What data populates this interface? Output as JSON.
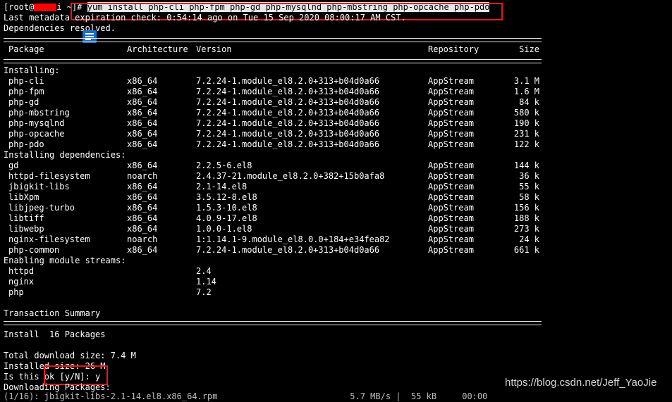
{
  "prompt": {
    "open": "[root@",
    "user_tail": "i ~]",
    "hash": "# ",
    "command": "yum install php-cli php-fpm php-gd php-mysqlnd php-mbstring php-opcache php-pdo"
  },
  "metadata_line": "Last metadata expiration check: 0:54:14 ago on Tue 15 Sep 2020 08:00:17 AM CST.",
  "deps_resolved": "Dependencies resolved.",
  "headers": {
    "package": "Package",
    "arch": "Architecture",
    "version": "Version",
    "repo": "Repository",
    "size": "Size"
  },
  "section_installing": "Installing:",
  "installing": [
    {
      "name": "php-cli",
      "arch": "x86_64",
      "version": "7.2.24-1.module_el8.2.0+313+b04d0a66",
      "repo": "AppStream",
      "size": "3.1 M"
    },
    {
      "name": "php-fpm",
      "arch": "x86_64",
      "version": "7.2.24-1.module_el8.2.0+313+b04d0a66",
      "repo": "AppStream",
      "size": "1.6 M"
    },
    {
      "name": "php-gd",
      "arch": "x86_64",
      "version": "7.2.24-1.module_el8.2.0+313+b04d0a66",
      "repo": "AppStream",
      "size": "84 k"
    },
    {
      "name": "php-mbstring",
      "arch": "x86_64",
      "version": "7.2.24-1.module_el8.2.0+313+b04d0a66",
      "repo": "AppStream",
      "size": "580 k"
    },
    {
      "name": "php-mysqlnd",
      "arch": "x86_64",
      "version": "7.2.24-1.module_el8.2.0+313+b04d0a66",
      "repo": "AppStream",
      "size": "190 k"
    },
    {
      "name": "php-opcache",
      "arch": "x86_64",
      "version": "7.2.24-1.module_el8.2.0+313+b04d0a66",
      "repo": "AppStream",
      "size": "231 k"
    },
    {
      "name": "php-pdo",
      "arch": "x86_64",
      "version": "7.2.24-1.module_el8.2.0+313+b04d0a66",
      "repo": "AppStream",
      "size": "122 k"
    }
  ],
  "section_deps": "Installing dependencies:",
  "dependencies": [
    {
      "name": "gd",
      "arch": "x86_64",
      "version": "2.2.5-6.el8",
      "repo": "AppStream",
      "size": "144 k"
    },
    {
      "name": "httpd-filesystem",
      "arch": "noarch",
      "version": "2.4.37-21.module_el8.2.0+382+15b0afa8",
      "repo": "AppStream",
      "size": "36 k"
    },
    {
      "name": "jbigkit-libs",
      "arch": "x86_64",
      "version": "2.1-14.el8",
      "repo": "AppStream",
      "size": "55 k"
    },
    {
      "name": "libXpm",
      "arch": "x86_64",
      "version": "3.5.12-8.el8",
      "repo": "AppStream",
      "size": "58 k"
    },
    {
      "name": "libjpeg-turbo",
      "arch": "x86_64",
      "version": "1.5.3-10.el8",
      "repo": "AppStream",
      "size": "156 k"
    },
    {
      "name": "libtiff",
      "arch": "x86_64",
      "version": "4.0.9-17.el8",
      "repo": "AppStream",
      "size": "188 k"
    },
    {
      "name": "libwebp",
      "arch": "x86_64",
      "version": "1.0.0-1.el8",
      "repo": "AppStream",
      "size": "273 k"
    },
    {
      "name": "nginx-filesystem",
      "arch": "noarch",
      "version": "1:1.14.1-9.module_el8.0.0+184+e34fea82",
      "repo": "AppStream",
      "size": "24 k"
    },
    {
      "name": "php-common",
      "arch": "x86_64",
      "version": "7.2.24-1.module_el8.2.0+313+b04d0a66",
      "repo": "AppStream",
      "size": "661 k"
    }
  ],
  "section_streams": "Enabling module streams:",
  "streams": [
    {
      "name": "httpd",
      "version": "2.4"
    },
    {
      "name": "nginx",
      "version": "1.14"
    },
    {
      "name": "php",
      "version": "7.2"
    }
  ],
  "transaction_summary": "Transaction Summary",
  "install_line": "Install  16 Packages",
  "total_download": "Total download size: 7.4 M",
  "installed_size": "Installed size: 26 M",
  "confirm_prompt": "Is this ok [y/N]: y",
  "downloading": "Downloading Packages:",
  "partial_line": "(1/16): jbigkit-libs-2.1-14.el8.x86_64.rpm                          5.7 MB/s |  55 kB     00:00",
  "watermark": "https://blog.csdn.net/Jeff_YaoJie",
  "colors": {
    "background": "#000000",
    "text": "#ffffff",
    "highlight_box": "#e51a1a",
    "redaction": "#ff0000"
  }
}
